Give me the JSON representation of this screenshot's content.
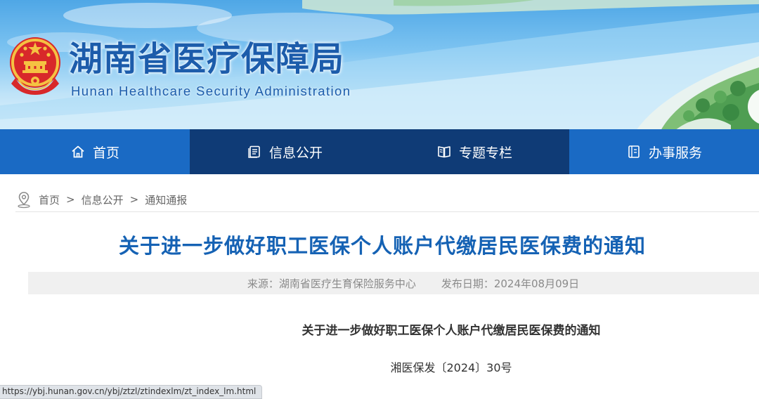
{
  "site": {
    "title": "湖南省医疗保障局",
    "subtitle": "Hunan Healthcare Security Administration",
    "emblem_icon": "national-emblem-icon"
  },
  "nav": {
    "items": [
      {
        "label": "首页",
        "icon": "home-icon"
      },
      {
        "label": "信息公开",
        "icon": "document-list-icon"
      },
      {
        "label": "专题专栏",
        "icon": "book-icon"
      },
      {
        "label": "办事服务",
        "icon": "service-guide-icon"
      }
    ]
  },
  "breadcrumb": {
    "icon": "location-pin-icon",
    "items": [
      "首页",
      "信息公开",
      "通知通报"
    ],
    "separator": ">"
  },
  "article": {
    "title": "关于进一步做好职工医保个人账户代缴居民医保费的通知",
    "source": "来源：湖南省医疗生育保险服务中心",
    "publish_date": "发布日期：2024年08月09日",
    "doc_title": "关于进一步做好职工医保个人账户代缴居民医保费的通知",
    "doc_number": "湘医保发〔2024〕30号"
  },
  "status_bar": {
    "url": "https://ybj.hunan.gov.cn/ybj/ztzl/ztindexlm/zt_index_lm.html"
  },
  "colors": {
    "nav_light": "#1a6ac4",
    "nav_dark": "#0f3b76",
    "title_blue": "#1562b4",
    "site_title_blue": "#1c5cab"
  }
}
